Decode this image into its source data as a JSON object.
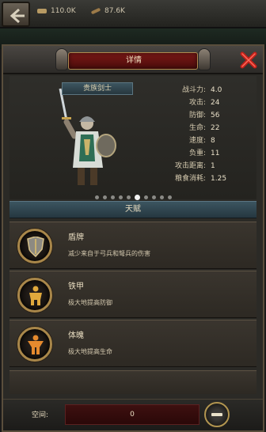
{
  "resources": {
    "food": "110.0K",
    "wood": "87.6K"
  },
  "dialog": {
    "title": "详情"
  },
  "hero": {
    "name": "贵族剑士",
    "stats": [
      {
        "label": "战斗力:",
        "value": "4.0"
      },
      {
        "label": "攻击:",
        "value": "24"
      },
      {
        "label": "防御:",
        "value": "56"
      },
      {
        "label": "生命:",
        "value": "22"
      },
      {
        "label": "速度:",
        "value": "8"
      },
      {
        "label": "负重:",
        "value": "11"
      },
      {
        "label": "攻击距离:",
        "value": "1"
      },
      {
        "label": "粮食消耗:",
        "value": "1.25"
      }
    ],
    "page_index": 5,
    "page_count": 10
  },
  "talents": {
    "header": "天赋",
    "items": [
      {
        "name": "盾牌",
        "desc": "减少来自于弓兵和弩兵的伤害",
        "icon": "shield-icon"
      },
      {
        "name": "铁甲",
        "desc": "极大地提高防御",
        "icon": "armor-icon"
      },
      {
        "name": "体魄",
        "desc": "极大地提高生命",
        "icon": "body-icon"
      }
    ]
  },
  "bottom": {
    "space_label": "空间:",
    "space_value": "0"
  },
  "colors": {
    "gold_trim": "#a9874a",
    "title_plate": "#7a1816",
    "talent_bar": "#3c5560"
  }
}
